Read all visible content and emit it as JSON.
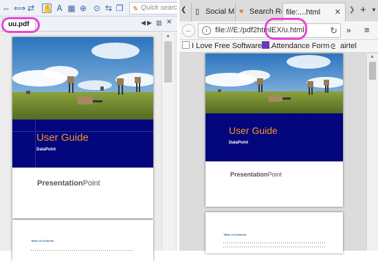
{
  "pdf_viewer": {
    "toolbar": {
      "quick_search_placeholder": "Quick searc",
      "icons": [
        "nav-arrows-icon",
        "fit-width-icon",
        "hand-tool-icon",
        "select-text-icon",
        "snapshot-icon",
        "zoom-icon",
        "find-icon",
        "rotate-icon",
        "copy-icon",
        "search-icon"
      ]
    },
    "tab_label": "uu.pdf"
  },
  "document": {
    "cover": {
      "title": "User Guide",
      "subtitle": "DataPoint",
      "brand_bold": "Presentation",
      "brand_light": "Point"
    },
    "toc_title": "Table of Contents"
  },
  "browser": {
    "tabs": [
      {
        "label": "Social Me...",
        "icon": "page-icon",
        "active": false
      },
      {
        "label": "Search Re...",
        "icon": "heart-icon",
        "active": false
      },
      {
        "label": "file:....html",
        "icon": "page-icon",
        "active": true
      }
    ],
    "url": "file:///E:/pdf2htmlEX/u.html",
    "bookmarks": [
      {
        "label": "I Love Free Software :...",
        "icon": "page-icon"
      },
      {
        "label": "Attendance Form",
        "icon": "form-icon"
      },
      {
        "label": "airtel",
        "icon": "airtel-icon"
      }
    ]
  },
  "colors": {
    "highlight": "#e844d8",
    "banner": "#04067e",
    "title_orange": "#f7931e",
    "sky": "#3f86c8"
  }
}
